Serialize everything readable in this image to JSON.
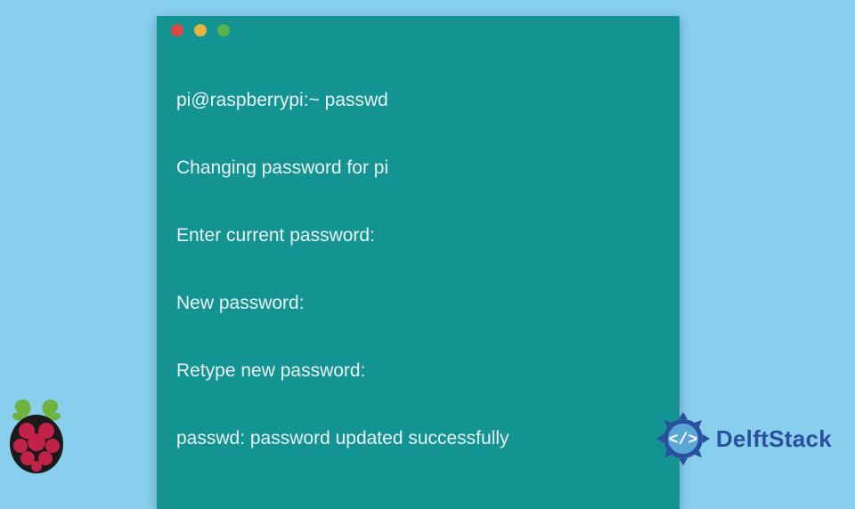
{
  "terminal": {
    "lines": [
      "pi@raspberrypi:~ passwd",
      "Changing password for pi",
      "Enter current password:",
      "New password:",
      "Retype new password:",
      "passwd: password updated successfully"
    ],
    "window_controls": {
      "close": "close",
      "minimize": "minimize",
      "maximize": "maximize"
    }
  },
  "branding": {
    "delftstack_label": "DelftStack",
    "raspberry_icon": "raspberry-pi-logo",
    "delftstack_icon": "delftstack-badge"
  },
  "colors": {
    "background": "#88ceed",
    "terminal_bg": "#149393",
    "terminal_fg": "#e9f3f3",
    "brand_blue": "#2a4f9e",
    "rpi_red": "#c22149",
    "rpi_green": "#6eb33f"
  }
}
